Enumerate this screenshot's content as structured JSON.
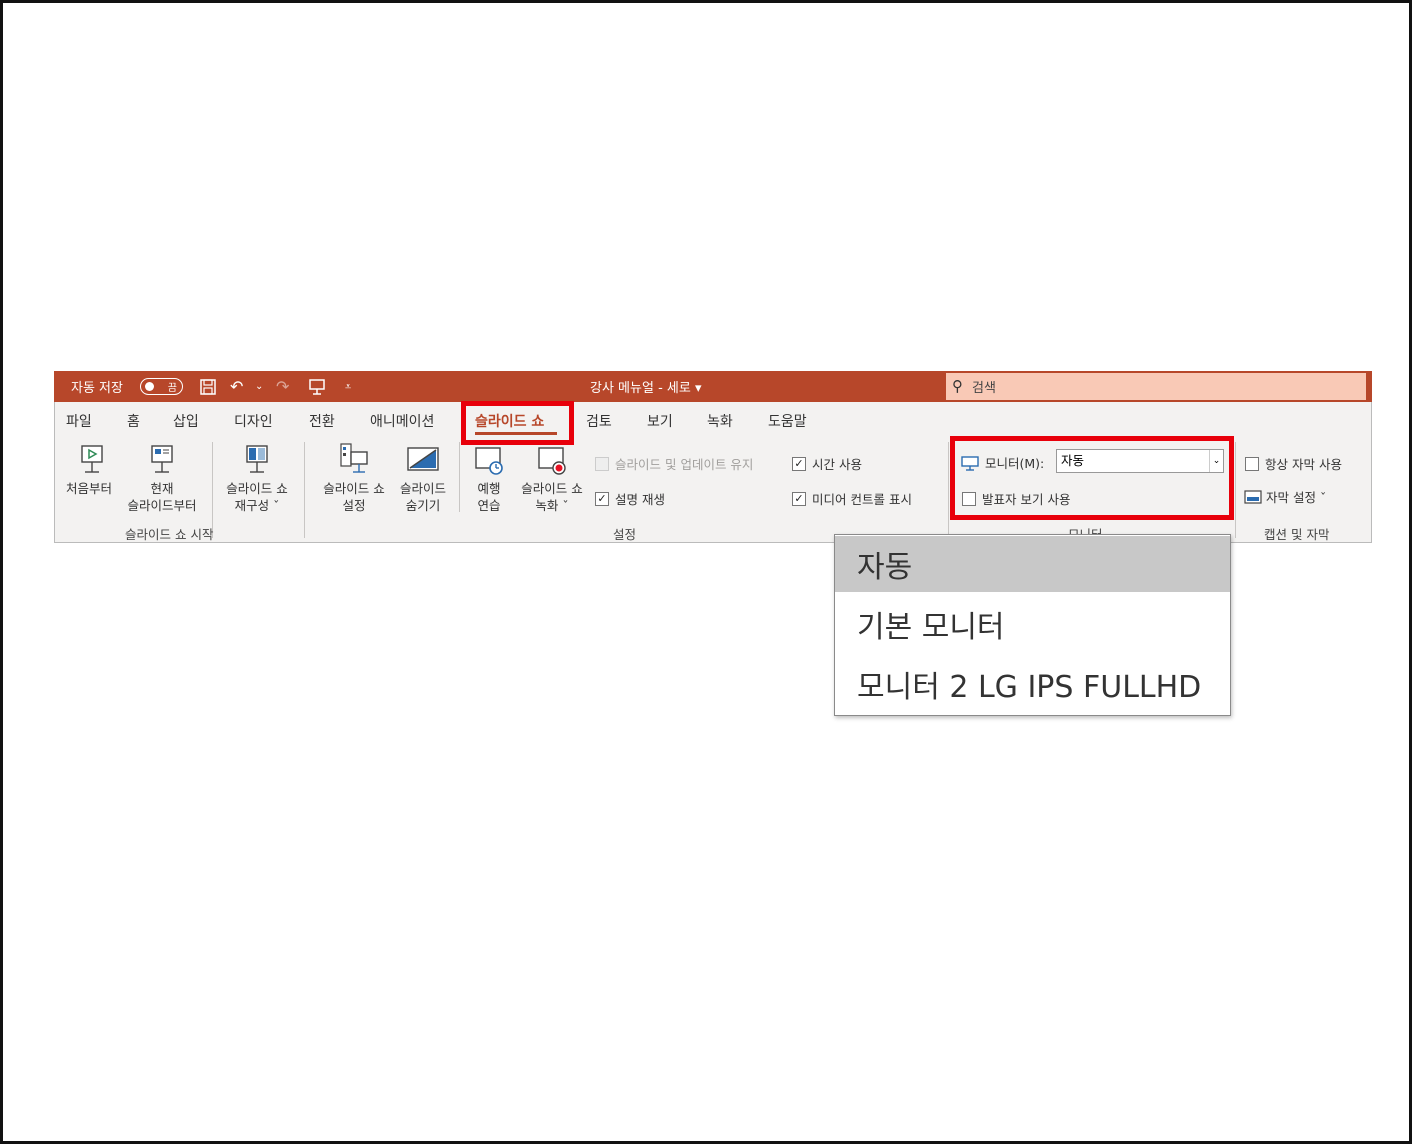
{
  "titlebar": {
    "autosave_label": "자동 저장",
    "autosave_state": "끔",
    "doc_title": "강사 메뉴얼 - 세로 ▾",
    "search_placeholder": "검색",
    "colors": {
      "bar": "#b7472a",
      "search": "#f9c9b6"
    }
  },
  "tabs": [
    "파일",
    "홈",
    "삽입",
    "디자인",
    "전환",
    "애니메이션",
    "슬라이드 쇼",
    "검토",
    "보기",
    "녹화",
    "도움말"
  ],
  "active_tab": "슬라이드 쇼",
  "ribbon": {
    "start_group": {
      "label": "슬라이드 쇼 시작",
      "buttons": [
        {
          "line1": "처음부터",
          "line2": ""
        },
        {
          "line1": "현재",
          "line2": "슬라이드부터"
        },
        {
          "line1": "슬라이드 쇼",
          "line2": "재구성 ˇ"
        }
      ]
    },
    "setup_group": {
      "label": "설정",
      "buttons": [
        {
          "line1": "슬라이드 쇼",
          "line2": "설정"
        },
        {
          "line1": "슬라이드",
          "line2": "숨기기"
        },
        {
          "line1": "예행",
          "line2": "연습"
        },
        {
          "line1": "슬라이드 쇼",
          "line2": "녹화 ˇ"
        }
      ],
      "checks": [
        {
          "label": "슬라이드 및 업데이트 유지",
          "checked": false,
          "disabled": true
        },
        {
          "label": "시간 사용",
          "checked": true
        },
        {
          "label": "설명 재생",
          "checked": true
        },
        {
          "label": "미디어 컨트롤 표시",
          "checked": true
        }
      ]
    },
    "monitor_group": {
      "label": "모니터",
      "monitor_label": "모니터(M):",
      "monitor_value": "자동",
      "presenter_view": "발표자 보기 사용"
    },
    "caption_group": {
      "label": "캡션 및 자막",
      "always_subtitles": "항상 자막 사용",
      "subtitle_settings": "자막 설정 ˇ"
    }
  },
  "dropdown": {
    "options": [
      "자동",
      "기본 모니터",
      "모니터 2 LG IPS FULLHD"
    ],
    "selected": "자동"
  },
  "highlight_color": "#e8000b"
}
